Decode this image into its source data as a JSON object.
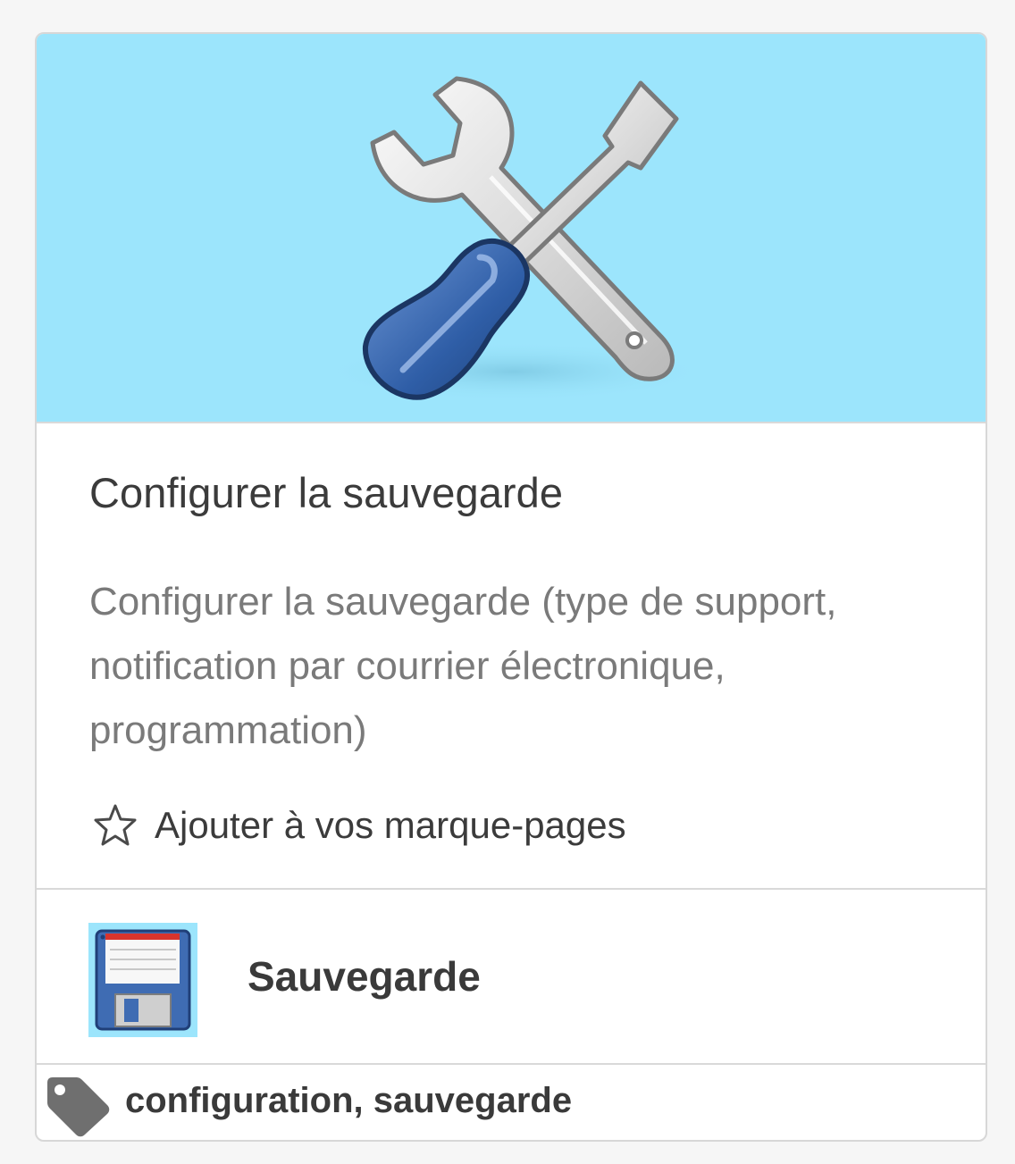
{
  "card": {
    "title": "Configurer la sauvegarde",
    "description": "Configurer la sauvegarde (type de support, notification par courrier électronique, programmation)",
    "bookmark_label": "Ajouter à vos marque-pages",
    "banner_icon": "tools-icon",
    "banner_color": "#9ce5fc"
  },
  "category": {
    "label": "Sauvegarde",
    "icon": "floppy-disk-icon"
  },
  "tags": {
    "icon": "tag-icon",
    "text": "configuration, sauvegarde"
  }
}
